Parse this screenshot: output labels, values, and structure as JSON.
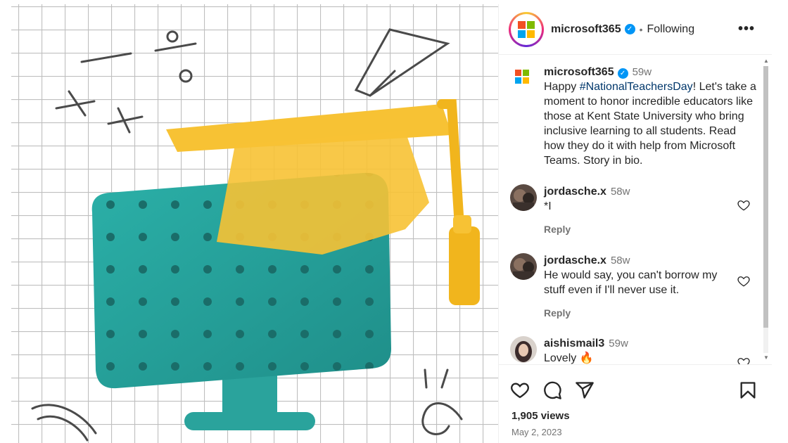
{
  "post": {
    "username": "microsoft365",
    "follow_status": "Following",
    "more_label": "•••",
    "separator": "•"
  },
  "caption": {
    "username": "microsoft365",
    "time": "59w",
    "text_before": "Happy ",
    "hashtag": "#NationalTeachersDay",
    "text_after": "! Let's take a moment to honor incredible educators like those at Kent State University who bring inclusive learning to all students. Read how they do it with help from Microsoft Teams. Story in bio."
  },
  "comments": [
    {
      "username": "jordasche.x",
      "time": "58w",
      "text": "*I",
      "reply_label": "Reply"
    },
    {
      "username": "jordasche.x",
      "time": "58w",
      "text": "He would say, you can't borrow my stuff even if I'll never use it.",
      "reply_label": "Reply"
    },
    {
      "username": "aishismail3",
      "time": "59w",
      "text": "Lovely 🔥"
    }
  ],
  "stats": {
    "views": "1,905 views",
    "date": "May 2, 2023"
  },
  "icons": {
    "like": "heart-icon",
    "comment": "comment-icon",
    "share": "share-icon",
    "save": "bookmark-icon",
    "verified": "verified-badge-icon",
    "more": "more-options-icon"
  },
  "colors": {
    "ms_red": "#f25022",
    "ms_green": "#7fba00",
    "ms_blue": "#00a4ef",
    "ms_yellow": "#ffb900",
    "teal": "#2ba6a0",
    "cap_yellow": "#f7c234",
    "verified_blue": "#0095f6",
    "link_blue": "#00376b"
  }
}
